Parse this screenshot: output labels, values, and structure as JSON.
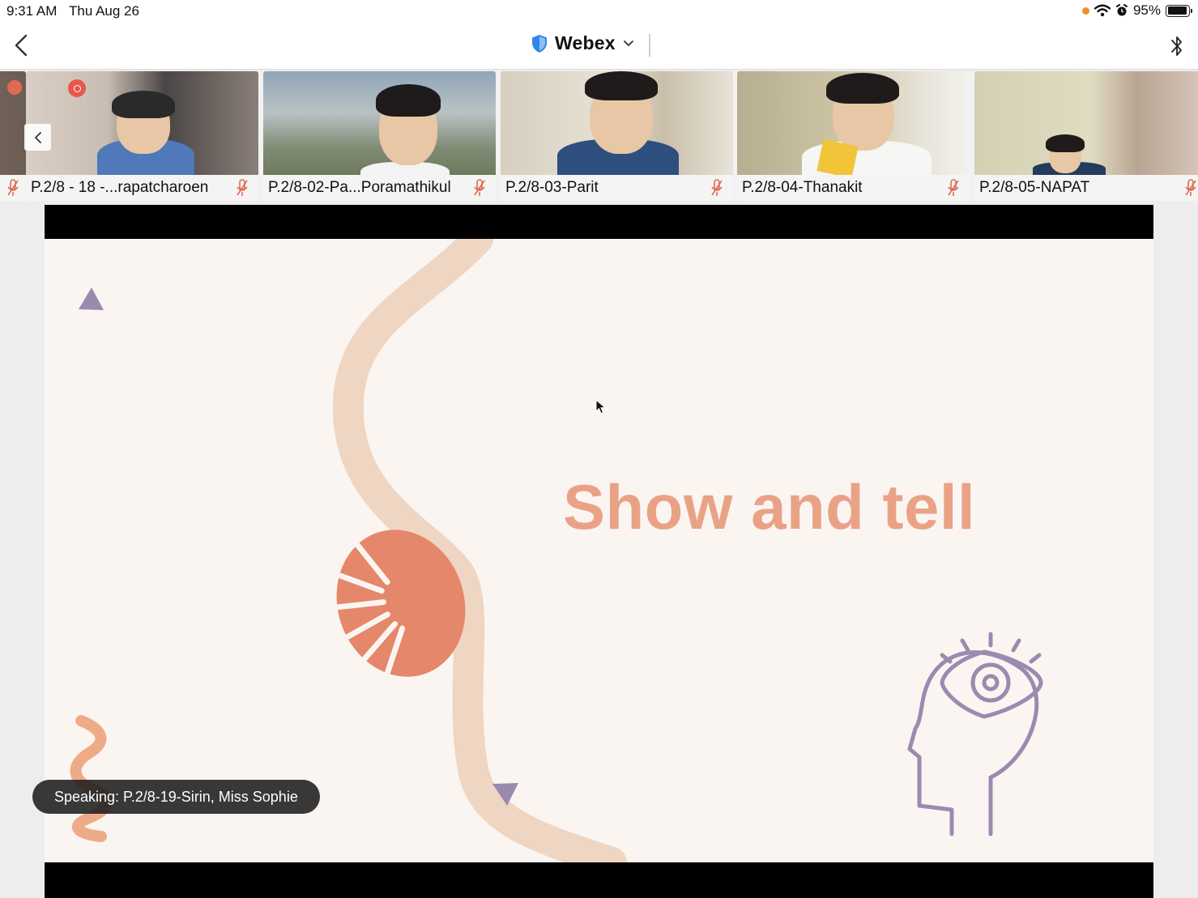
{
  "status_bar": {
    "time": "9:31 AM",
    "date": "Thu Aug 26",
    "battery": "95%",
    "battery_level": 0.95
  },
  "nav": {
    "title": "Webex",
    "icons": [
      "chevron-left-icon",
      "shield-icon",
      "chevron-down-icon",
      "bluetooth-icon"
    ]
  },
  "participants": [
    {
      "name": "P.2/8 - 18 -...rapatcharoen",
      "muted": true
    },
    {
      "name": "P.2/8-02-Pa...Poramathikul",
      "muted": true
    },
    {
      "name": "P.2/8-03-Parit",
      "muted": true
    },
    {
      "name": "P.2/8-04-Thanakit",
      "muted": true
    },
    {
      "name": "P.2/8-05-NAPAT",
      "muted": true
    }
  ],
  "slide": {
    "title": "Show and tell"
  },
  "speaking": "Speaking: P.2/8-19-Sirin, Miss Sophie",
  "colors": {
    "title": "#eaa286",
    "leaf": "#e5876a",
    "path": "#efd6c2",
    "accent_purple": "#9b8ab0",
    "mute_red": "#e06a50",
    "shield_blue": "#2f86e6"
  }
}
